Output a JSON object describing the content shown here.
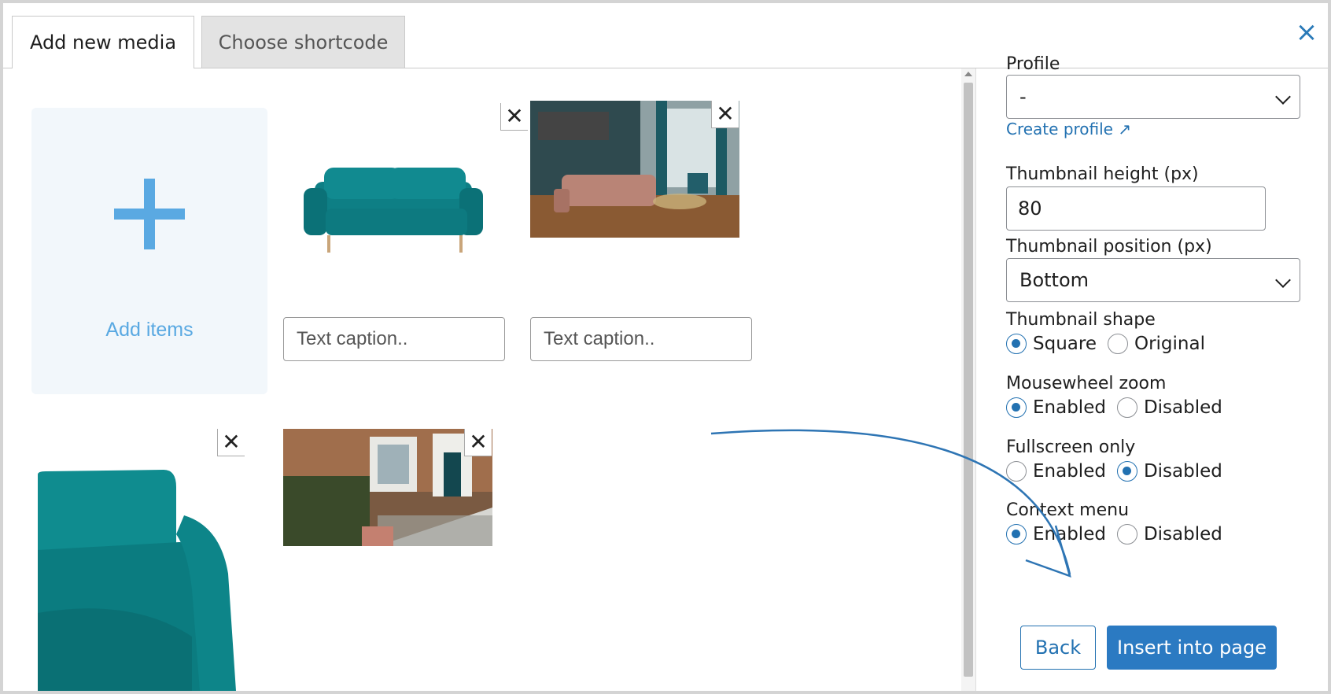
{
  "tabs": [
    {
      "label": "Add new media",
      "active": true
    },
    {
      "label": "Choose shortcode",
      "active": false
    }
  ],
  "close_icon": "×",
  "media": {
    "add_label": "Add items",
    "caption_placeholder": "Text caption..",
    "remove_glyph": "✕",
    "items": [
      {
        "name": "teal sofa product photo"
      },
      {
        "name": "living room interior photo"
      },
      {
        "name": "teal armchair closeup photo"
      },
      {
        "name": "house front garden photo"
      }
    ]
  },
  "panel": {
    "profile_label": "Profile",
    "profile_value": "-",
    "create_profile": "Create profile ↗",
    "thumb_height_label": "Thumbnail height (px)",
    "thumb_height_value": "80",
    "thumb_position_label": "Thumbnail position (px)",
    "thumb_position_value": "Bottom",
    "thumb_shape_label": "Thumbnail shape",
    "thumb_shape_options": [
      "Square",
      "Original"
    ],
    "mousewheel_label": "Mousewheel zoom",
    "fullscreen_label": "Fullscreen only",
    "context_label": "Context menu",
    "enabled": "Enabled",
    "disabled": "Disabled",
    "back": "Back",
    "insert": "Insert into page"
  },
  "colors": {
    "accent": "#2271b1",
    "add_tile": "#5aa9e2"
  }
}
